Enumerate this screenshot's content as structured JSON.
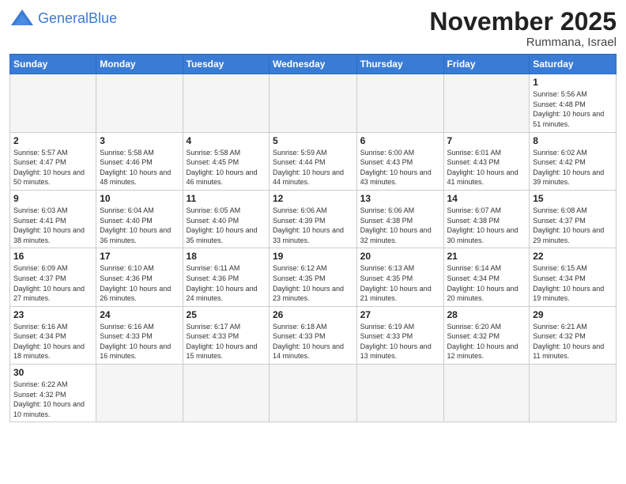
{
  "header": {
    "logo_general": "General",
    "logo_blue": "Blue",
    "month_title": "November 2025",
    "location": "Rummana, Israel"
  },
  "days_of_week": [
    "Sunday",
    "Monday",
    "Tuesday",
    "Wednesday",
    "Thursday",
    "Friday",
    "Saturday"
  ],
  "weeks": [
    [
      {
        "day": "",
        "info": ""
      },
      {
        "day": "",
        "info": ""
      },
      {
        "day": "",
        "info": ""
      },
      {
        "day": "",
        "info": ""
      },
      {
        "day": "",
        "info": ""
      },
      {
        "day": "",
        "info": ""
      },
      {
        "day": "1",
        "info": "Sunrise: 5:56 AM\nSunset: 4:48 PM\nDaylight: 10 hours and 51 minutes."
      }
    ],
    [
      {
        "day": "2",
        "info": "Sunrise: 5:57 AM\nSunset: 4:47 PM\nDaylight: 10 hours and 50 minutes."
      },
      {
        "day": "3",
        "info": "Sunrise: 5:58 AM\nSunset: 4:46 PM\nDaylight: 10 hours and 48 minutes."
      },
      {
        "day": "4",
        "info": "Sunrise: 5:58 AM\nSunset: 4:45 PM\nDaylight: 10 hours and 46 minutes."
      },
      {
        "day": "5",
        "info": "Sunrise: 5:59 AM\nSunset: 4:44 PM\nDaylight: 10 hours and 44 minutes."
      },
      {
        "day": "6",
        "info": "Sunrise: 6:00 AM\nSunset: 4:43 PM\nDaylight: 10 hours and 43 minutes."
      },
      {
        "day": "7",
        "info": "Sunrise: 6:01 AM\nSunset: 4:43 PM\nDaylight: 10 hours and 41 minutes."
      },
      {
        "day": "8",
        "info": "Sunrise: 6:02 AM\nSunset: 4:42 PM\nDaylight: 10 hours and 39 minutes."
      }
    ],
    [
      {
        "day": "9",
        "info": "Sunrise: 6:03 AM\nSunset: 4:41 PM\nDaylight: 10 hours and 38 minutes."
      },
      {
        "day": "10",
        "info": "Sunrise: 6:04 AM\nSunset: 4:40 PM\nDaylight: 10 hours and 36 minutes."
      },
      {
        "day": "11",
        "info": "Sunrise: 6:05 AM\nSunset: 4:40 PM\nDaylight: 10 hours and 35 minutes."
      },
      {
        "day": "12",
        "info": "Sunrise: 6:06 AM\nSunset: 4:39 PM\nDaylight: 10 hours and 33 minutes."
      },
      {
        "day": "13",
        "info": "Sunrise: 6:06 AM\nSunset: 4:38 PM\nDaylight: 10 hours and 32 minutes."
      },
      {
        "day": "14",
        "info": "Sunrise: 6:07 AM\nSunset: 4:38 PM\nDaylight: 10 hours and 30 minutes."
      },
      {
        "day": "15",
        "info": "Sunrise: 6:08 AM\nSunset: 4:37 PM\nDaylight: 10 hours and 29 minutes."
      }
    ],
    [
      {
        "day": "16",
        "info": "Sunrise: 6:09 AM\nSunset: 4:37 PM\nDaylight: 10 hours and 27 minutes."
      },
      {
        "day": "17",
        "info": "Sunrise: 6:10 AM\nSunset: 4:36 PM\nDaylight: 10 hours and 26 minutes."
      },
      {
        "day": "18",
        "info": "Sunrise: 6:11 AM\nSunset: 4:36 PM\nDaylight: 10 hours and 24 minutes."
      },
      {
        "day": "19",
        "info": "Sunrise: 6:12 AM\nSunset: 4:35 PM\nDaylight: 10 hours and 23 minutes."
      },
      {
        "day": "20",
        "info": "Sunrise: 6:13 AM\nSunset: 4:35 PM\nDaylight: 10 hours and 21 minutes."
      },
      {
        "day": "21",
        "info": "Sunrise: 6:14 AM\nSunset: 4:34 PM\nDaylight: 10 hours and 20 minutes."
      },
      {
        "day": "22",
        "info": "Sunrise: 6:15 AM\nSunset: 4:34 PM\nDaylight: 10 hours and 19 minutes."
      }
    ],
    [
      {
        "day": "23",
        "info": "Sunrise: 6:16 AM\nSunset: 4:34 PM\nDaylight: 10 hours and 18 minutes."
      },
      {
        "day": "24",
        "info": "Sunrise: 6:16 AM\nSunset: 4:33 PM\nDaylight: 10 hours and 16 minutes."
      },
      {
        "day": "25",
        "info": "Sunrise: 6:17 AM\nSunset: 4:33 PM\nDaylight: 10 hours and 15 minutes."
      },
      {
        "day": "26",
        "info": "Sunrise: 6:18 AM\nSunset: 4:33 PM\nDaylight: 10 hours and 14 minutes."
      },
      {
        "day": "27",
        "info": "Sunrise: 6:19 AM\nSunset: 4:33 PM\nDaylight: 10 hours and 13 minutes."
      },
      {
        "day": "28",
        "info": "Sunrise: 6:20 AM\nSunset: 4:32 PM\nDaylight: 10 hours and 12 minutes."
      },
      {
        "day": "29",
        "info": "Sunrise: 6:21 AM\nSunset: 4:32 PM\nDaylight: 10 hours and 11 minutes."
      }
    ],
    [
      {
        "day": "30",
        "info": "Sunrise: 6:22 AM\nSunset: 4:32 PM\nDaylight: 10 hours and 10 minutes."
      },
      {
        "day": "",
        "info": ""
      },
      {
        "day": "",
        "info": ""
      },
      {
        "day": "",
        "info": ""
      },
      {
        "day": "",
        "info": ""
      },
      {
        "day": "",
        "info": ""
      },
      {
        "day": "",
        "info": ""
      }
    ]
  ]
}
